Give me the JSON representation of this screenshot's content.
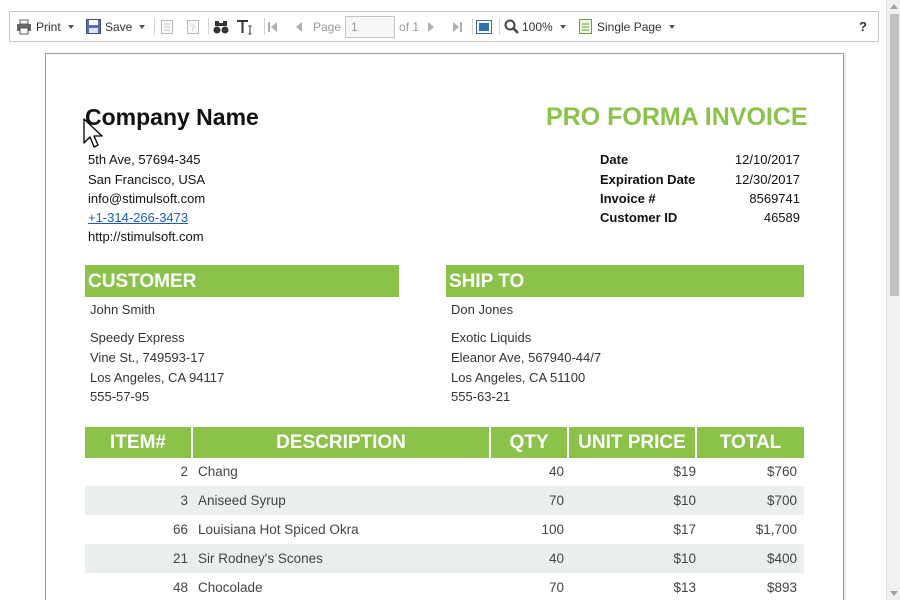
{
  "toolbar": {
    "print_label": "Print",
    "save_label": "Save",
    "page_label": "Page",
    "page_value": "1",
    "page_of": "of 1",
    "zoom_label": "100%",
    "view_mode_label": "Single Page",
    "help_label": "?"
  },
  "invoice": {
    "company_name": "Company Name",
    "title": "PRO FORMA INVOICE",
    "accent_color": "#8bc34a",
    "address": {
      "line1": "5th Ave, 57694-345",
      "line2": "San Francisco, USA",
      "email": "info@stimulsoft.com",
      "phone": "+1-314-266-3473",
      "website": "http://stimulsoft.com"
    },
    "meta": [
      {
        "label": "Date",
        "value": "12/10/2017"
      },
      {
        "label": "Expiration Date",
        "value": "12/30/2017"
      },
      {
        "label": "Invoice #",
        "value": "8569741"
      },
      {
        "label": "Customer ID",
        "value": "46589"
      }
    ],
    "customer": {
      "heading": "CUSTOMER",
      "name": "John Smith",
      "company": "Speedy Express",
      "street": "Vine St., 749593-17",
      "city": "Los Angeles, CA 94117",
      "phone": "555-57-95"
    },
    "ship_to": {
      "heading": "SHIP TO",
      "name": "Don Jones",
      "company": "Exotic Liquids",
      "street": "Eleanor Ave, 567940-44/7",
      "city": "Los Angeles, CA 51100",
      "phone": "555-63-21"
    },
    "table": {
      "headers": [
        "ITEM#",
        "DESCRIPTION",
        "QTY",
        "UNIT PRICE",
        "TOTAL"
      ],
      "rows": [
        {
          "item": "2",
          "description": "Chang",
          "qty": "40",
          "unit_price": "$19",
          "total": "$760"
        },
        {
          "item": "3",
          "description": "Aniseed Syrup",
          "qty": "70",
          "unit_price": "$10",
          "total": "$700"
        },
        {
          "item": "66",
          "description": "Louisiana Hot Spiced Okra",
          "qty": "100",
          "unit_price": "$17",
          "total": "$1,700"
        },
        {
          "item": "21",
          "description": "Sir Rodney's Scones",
          "qty": "40",
          "unit_price": "$10",
          "total": "$400"
        },
        {
          "item": "48",
          "description": "Chocolade",
          "qty": "70",
          "unit_price": "$13",
          "total": "$893"
        }
      ]
    }
  }
}
